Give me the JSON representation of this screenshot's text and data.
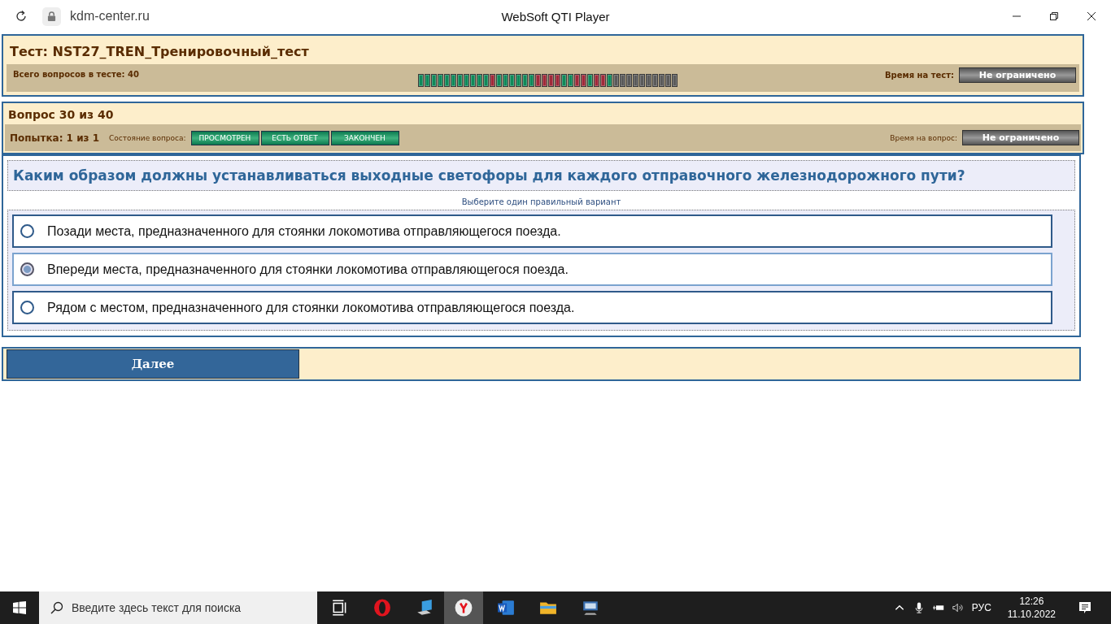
{
  "browser": {
    "address": "kdm-center.ru",
    "title": "WebSoft QTI Player"
  },
  "test": {
    "title": "Тест: NST27_TREN_Тренировочный_тест",
    "total_label": "Всего вопросов в тесте: 40",
    "time_label": "Время на тест:",
    "time_value": "Не ограничено",
    "progress": [
      {
        "color": "#0f8a5a"
      },
      {
        "color": "#0f8a5a"
      },
      {
        "color": "#0f8a5a"
      },
      {
        "color": "#0f8a5a"
      },
      {
        "color": "#0f8a5a"
      },
      {
        "color": "#0f8a5a"
      },
      {
        "color": "#0f8a5a"
      },
      {
        "color": "#0f8a5a"
      },
      {
        "color": "#0f8a5a"
      },
      {
        "color": "#0f8a5a"
      },
      {
        "color": "#0f8a5a"
      },
      {
        "color": "#a02a3a"
      },
      {
        "color": "#0f8a5a"
      },
      {
        "color": "#0f8a5a"
      },
      {
        "color": "#0f8a5a"
      },
      {
        "color": "#0f8a5a"
      },
      {
        "color": "#0f8a5a"
      },
      {
        "color": "#0f8a5a"
      },
      {
        "color": "#a02a3a"
      },
      {
        "color": "#a02a3a"
      },
      {
        "color": "#a02a3a"
      },
      {
        "color": "#a02a3a"
      },
      {
        "color": "#0f8a5a"
      },
      {
        "color": "#0f8a5a"
      },
      {
        "color": "#a02a3a"
      },
      {
        "color": "#a02a3a"
      },
      {
        "color": "#0f8a5a"
      },
      {
        "color": "#a02a3a"
      },
      {
        "color": "#a02a3a"
      },
      {
        "color": "#0f8a5a"
      },
      {
        "color": "#5a5a5a"
      },
      {
        "color": "#5a5a5a"
      },
      {
        "color": "#5a5a5a"
      },
      {
        "color": "#5a5a5a"
      },
      {
        "color": "#5a5a5a"
      },
      {
        "color": "#5a5a5a"
      },
      {
        "color": "#5a5a5a"
      },
      {
        "color": "#5a5a5a"
      },
      {
        "color": "#5a5a5a"
      },
      {
        "color": "#5a5a5a"
      }
    ]
  },
  "question": {
    "number": "Вопрос 30 из 40",
    "attempt": "Попытка: 1 из 1",
    "state_label": "Состояние вопроса:",
    "states": [
      "ПРОСМОТРЕН",
      "ЕСТЬ ОТВЕТ",
      "ЗАКОНЧЕН"
    ],
    "time_label": "Время на вопрос:",
    "time_value": "Не ограничено",
    "text": "Каким образом должны устанавливаться выходные светофоры для каждого отправочного железнодорожного пути?",
    "hint": "Выберите один правильный вариант",
    "options": [
      {
        "label": "Позади места, предназначенного для стоянки локомотива отправляющегося поезда.",
        "selected": false
      },
      {
        "label": "Впереди места, предназначенного для стоянки локомотива отправляющегося поезда.",
        "selected": true
      },
      {
        "label": "Рядом с местом, предназначенного для стоянки локомотива отправляющегося поезда.",
        "selected": false
      }
    ]
  },
  "next_button": "Далее",
  "taskbar": {
    "search_placeholder": "Введите здесь текст для поиска",
    "language": "РУС",
    "time": "12:26",
    "date": "11.10.2022"
  }
}
